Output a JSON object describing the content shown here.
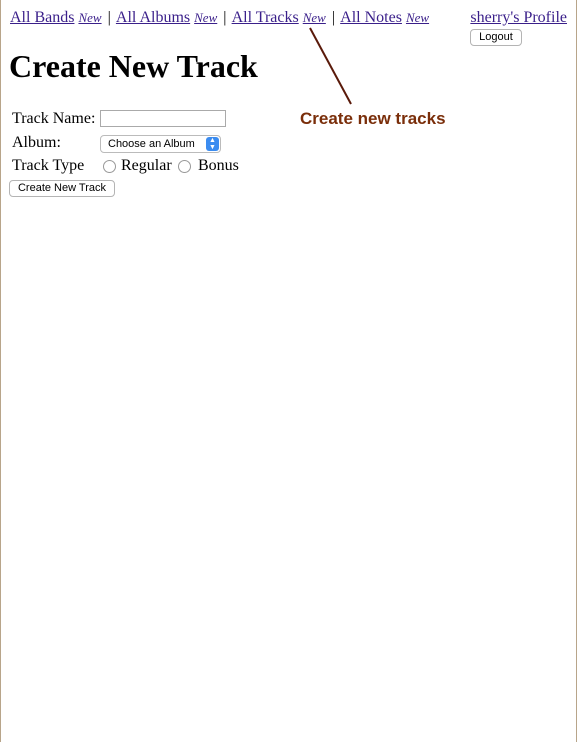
{
  "nav": {
    "bands": "All Bands",
    "bands_new": "New",
    "albums": "All Albums",
    "albums_new": "New",
    "tracks": "All Tracks",
    "tracks_new": "New",
    "notes": "All Notes",
    "notes_new": "New",
    "separator": "|"
  },
  "user": {
    "profile_link": "sherry's Profile",
    "logout_label": "Logout"
  },
  "page": {
    "title": "Create New Track"
  },
  "form": {
    "track_name_label": "Track Name:",
    "track_name_value": "",
    "album_label": "Album:",
    "album_selected": "Choose an Album",
    "track_type_label": "Track Type",
    "radio_regular": "Regular",
    "radio_bonus": "Bonus",
    "submit_label": "Create New Track"
  },
  "annotation": {
    "text": "Create new tracks",
    "color": "#7a2e0a"
  }
}
